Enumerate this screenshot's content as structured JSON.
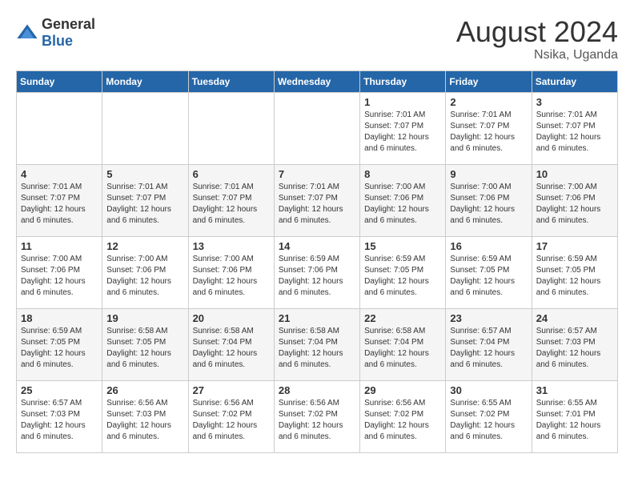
{
  "logo": {
    "general": "General",
    "blue": "Blue"
  },
  "title": "August 2024",
  "subtitle": "Nsika, Uganda",
  "weekdays": [
    "Sunday",
    "Monday",
    "Tuesday",
    "Wednesday",
    "Thursday",
    "Friday",
    "Saturday"
  ],
  "weeks": [
    [
      {
        "day": "",
        "sunrise": "",
        "sunset": "",
        "daylight": ""
      },
      {
        "day": "",
        "sunrise": "",
        "sunset": "",
        "daylight": ""
      },
      {
        "day": "",
        "sunrise": "",
        "sunset": "",
        "daylight": ""
      },
      {
        "day": "",
        "sunrise": "",
        "sunset": "",
        "daylight": ""
      },
      {
        "day": "1",
        "sunrise": "Sunrise: 7:01 AM",
        "sunset": "Sunset: 7:07 PM",
        "daylight": "Daylight: 12 hours and 6 minutes."
      },
      {
        "day": "2",
        "sunrise": "Sunrise: 7:01 AM",
        "sunset": "Sunset: 7:07 PM",
        "daylight": "Daylight: 12 hours and 6 minutes."
      },
      {
        "day": "3",
        "sunrise": "Sunrise: 7:01 AM",
        "sunset": "Sunset: 7:07 PM",
        "daylight": "Daylight: 12 hours and 6 minutes."
      }
    ],
    [
      {
        "day": "4",
        "sunrise": "Sunrise: 7:01 AM",
        "sunset": "Sunset: 7:07 PM",
        "daylight": "Daylight: 12 hours and 6 minutes."
      },
      {
        "day": "5",
        "sunrise": "Sunrise: 7:01 AM",
        "sunset": "Sunset: 7:07 PM",
        "daylight": "Daylight: 12 hours and 6 minutes."
      },
      {
        "day": "6",
        "sunrise": "Sunrise: 7:01 AM",
        "sunset": "Sunset: 7:07 PM",
        "daylight": "Daylight: 12 hours and 6 minutes."
      },
      {
        "day": "7",
        "sunrise": "Sunrise: 7:01 AM",
        "sunset": "Sunset: 7:07 PM",
        "daylight": "Daylight: 12 hours and 6 minutes."
      },
      {
        "day": "8",
        "sunrise": "Sunrise: 7:00 AM",
        "sunset": "Sunset: 7:06 PM",
        "daylight": "Daylight: 12 hours and 6 minutes."
      },
      {
        "day": "9",
        "sunrise": "Sunrise: 7:00 AM",
        "sunset": "Sunset: 7:06 PM",
        "daylight": "Daylight: 12 hours and 6 minutes."
      },
      {
        "day": "10",
        "sunrise": "Sunrise: 7:00 AM",
        "sunset": "Sunset: 7:06 PM",
        "daylight": "Daylight: 12 hours and 6 minutes."
      }
    ],
    [
      {
        "day": "11",
        "sunrise": "Sunrise: 7:00 AM",
        "sunset": "Sunset: 7:06 PM",
        "daylight": "Daylight: 12 hours and 6 minutes."
      },
      {
        "day": "12",
        "sunrise": "Sunrise: 7:00 AM",
        "sunset": "Sunset: 7:06 PM",
        "daylight": "Daylight: 12 hours and 6 minutes."
      },
      {
        "day": "13",
        "sunrise": "Sunrise: 7:00 AM",
        "sunset": "Sunset: 7:06 PM",
        "daylight": "Daylight: 12 hours and 6 minutes."
      },
      {
        "day": "14",
        "sunrise": "Sunrise: 6:59 AM",
        "sunset": "Sunset: 7:06 PM",
        "daylight": "Daylight: 12 hours and 6 minutes."
      },
      {
        "day": "15",
        "sunrise": "Sunrise: 6:59 AM",
        "sunset": "Sunset: 7:05 PM",
        "daylight": "Daylight: 12 hours and 6 minutes."
      },
      {
        "day": "16",
        "sunrise": "Sunrise: 6:59 AM",
        "sunset": "Sunset: 7:05 PM",
        "daylight": "Daylight: 12 hours and 6 minutes."
      },
      {
        "day": "17",
        "sunrise": "Sunrise: 6:59 AM",
        "sunset": "Sunset: 7:05 PM",
        "daylight": "Daylight: 12 hours and 6 minutes."
      }
    ],
    [
      {
        "day": "18",
        "sunrise": "Sunrise: 6:59 AM",
        "sunset": "Sunset: 7:05 PM",
        "daylight": "Daylight: 12 hours and 6 minutes."
      },
      {
        "day": "19",
        "sunrise": "Sunrise: 6:58 AM",
        "sunset": "Sunset: 7:05 PM",
        "daylight": "Daylight: 12 hours and 6 minutes."
      },
      {
        "day": "20",
        "sunrise": "Sunrise: 6:58 AM",
        "sunset": "Sunset: 7:04 PM",
        "daylight": "Daylight: 12 hours and 6 minutes."
      },
      {
        "day": "21",
        "sunrise": "Sunrise: 6:58 AM",
        "sunset": "Sunset: 7:04 PM",
        "daylight": "Daylight: 12 hours and 6 minutes."
      },
      {
        "day": "22",
        "sunrise": "Sunrise: 6:58 AM",
        "sunset": "Sunset: 7:04 PM",
        "daylight": "Daylight: 12 hours and 6 minutes."
      },
      {
        "day": "23",
        "sunrise": "Sunrise: 6:57 AM",
        "sunset": "Sunset: 7:04 PM",
        "daylight": "Daylight: 12 hours and 6 minutes."
      },
      {
        "day": "24",
        "sunrise": "Sunrise: 6:57 AM",
        "sunset": "Sunset: 7:03 PM",
        "daylight": "Daylight: 12 hours and 6 minutes."
      }
    ],
    [
      {
        "day": "25",
        "sunrise": "Sunrise: 6:57 AM",
        "sunset": "Sunset: 7:03 PM",
        "daylight": "Daylight: 12 hours and 6 minutes."
      },
      {
        "day": "26",
        "sunrise": "Sunrise: 6:56 AM",
        "sunset": "Sunset: 7:03 PM",
        "daylight": "Daylight: 12 hours and 6 minutes."
      },
      {
        "day": "27",
        "sunrise": "Sunrise: 6:56 AM",
        "sunset": "Sunset: 7:02 PM",
        "daylight": "Daylight: 12 hours and 6 minutes."
      },
      {
        "day": "28",
        "sunrise": "Sunrise: 6:56 AM",
        "sunset": "Sunset: 7:02 PM",
        "daylight": "Daylight: 12 hours and 6 minutes."
      },
      {
        "day": "29",
        "sunrise": "Sunrise: 6:56 AM",
        "sunset": "Sunset: 7:02 PM",
        "daylight": "Daylight: 12 hours and 6 minutes."
      },
      {
        "day": "30",
        "sunrise": "Sunrise: 6:55 AM",
        "sunset": "Sunset: 7:02 PM",
        "daylight": "Daylight: 12 hours and 6 minutes."
      },
      {
        "day": "31",
        "sunrise": "Sunrise: 6:55 AM",
        "sunset": "Sunset: 7:01 PM",
        "daylight": "Daylight: 12 hours and 6 minutes."
      }
    ]
  ]
}
